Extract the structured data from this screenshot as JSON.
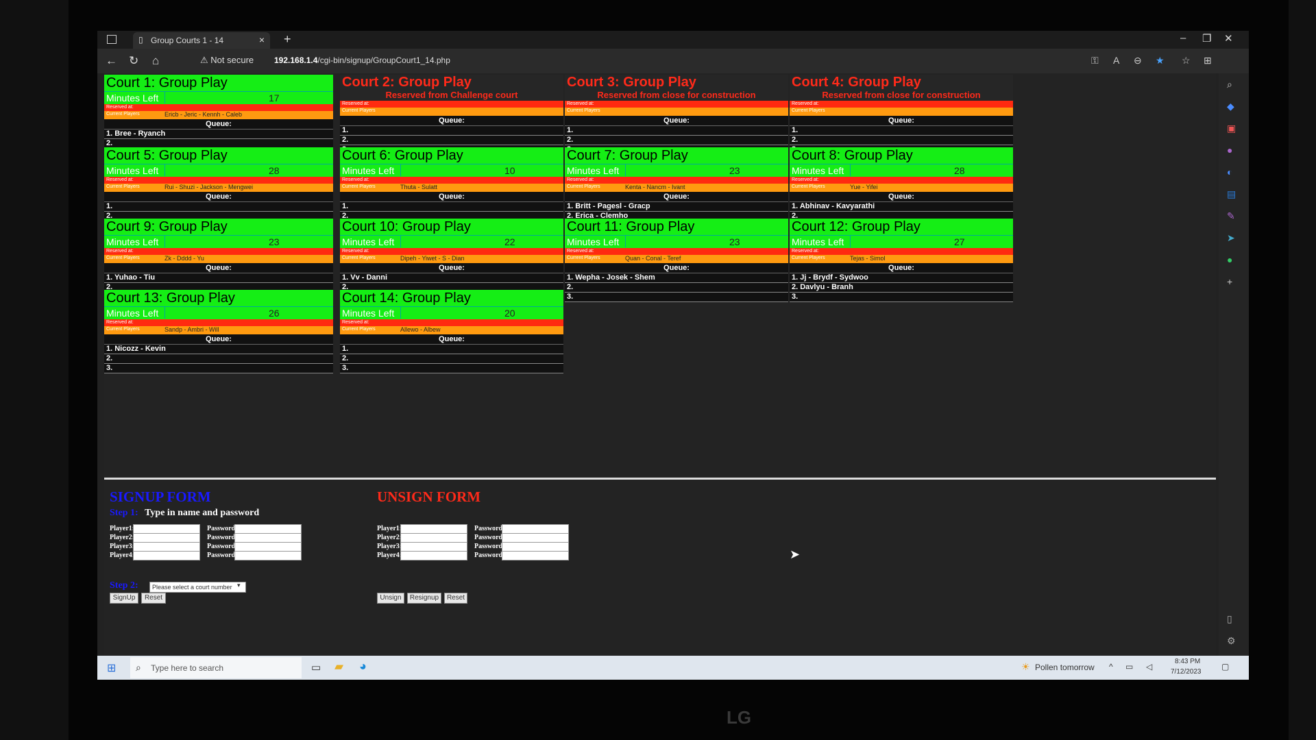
{
  "browser": {
    "tab_title": "Group Courts 1 - 14",
    "security": "Not secure",
    "url_host": "192.168.1.4",
    "url_path": "/cgi-bin/signup/GroupCourt1_14.php"
  },
  "labels": {
    "minutes_left": "Minutes Left",
    "reserved_at": "Reserved at:",
    "current_players": "Current Players",
    "queue": "Queue:"
  },
  "courts": [
    {
      "title": "Court 1: Group Play",
      "minutes": "17",
      "players": "Ericb - Jeric - Kennh - Caleb",
      "queue": [
        "1. Bree - Ryanch",
        "2.",
        "3."
      ]
    },
    {
      "title": "Court 2: Group Play",
      "reserved": "Reserved from Challenge court",
      "minutes": "",
      "players": "",
      "queue": [
        "1.",
        "2.",
        "3."
      ]
    },
    {
      "title": "Court 3: Group Play",
      "reserved": "Reserved from close for construction",
      "minutes": "",
      "players": "",
      "queue": [
        "1.",
        "2.",
        "3."
      ]
    },
    {
      "title": "Court 4: Group Play",
      "reserved": "Reserved from close for construction",
      "minutes": "",
      "players": "",
      "queue": [
        "1.",
        "2.",
        "3."
      ]
    },
    {
      "title": "Court 5: Group Play",
      "minutes": "28",
      "players": "Rui - Shuzi - Jackson - Mengwei",
      "queue": [
        "1.",
        "2.",
        "3."
      ]
    },
    {
      "title": "Court 6: Group Play",
      "minutes": "10",
      "players": "Thuta - Sulatt",
      "queue": [
        "1.",
        "2.",
        "3."
      ]
    },
    {
      "title": "Court 7: Group Play",
      "minutes": "23",
      "players": "Kenta - Nancm - Ivant",
      "queue": [
        "1. Britt - Pagesl - Gracp",
        "2. Erica - Clemho",
        "3."
      ]
    },
    {
      "title": "Court 8: Group Play",
      "minutes": "28",
      "players": "Yue - Yifei",
      "queue": [
        "1. Abhinav - Kavyarathi",
        "2.",
        "3."
      ]
    },
    {
      "title": "Court 9: Group Play",
      "minutes": "23",
      "players": "Zk - Dddd - Yu",
      "queue": [
        "1. Yuhao - Tiu",
        "2.",
        "3."
      ]
    },
    {
      "title": "Court 10: Group Play",
      "minutes": "22",
      "players": "Dipeh - Yiwet - S - Dian",
      "queue": [
        "1. Vv - Danni",
        "2.",
        "3."
      ]
    },
    {
      "title": "Court 11: Group Play",
      "minutes": "23",
      "players": "Quan - Conal - Teref",
      "queue": [
        "1. Wepha - Josek - Shem",
        "2.",
        "3."
      ]
    },
    {
      "title": "Court 12: Group Play",
      "minutes": "27",
      "players": "Tejas - Simol",
      "queue": [
        "1. Jj - Brydf - Sydwoo",
        "2. Davlyu - Branh",
        "3."
      ]
    },
    {
      "title": "Court 13: Group Play",
      "minutes": "26",
      "players": "Sandp - Ambri - Will",
      "queue": [
        "1. Nicozz - Kevin",
        "2.",
        "3."
      ]
    },
    {
      "title": "Court 14: Group Play",
      "minutes": "20",
      "players": "Allewo - Albew",
      "queue": [
        "1.",
        "2.",
        "3."
      ]
    }
  ],
  "signup": {
    "title": "SIGNUP FORM",
    "step1": "Step 1:",
    "step1_text": "Type in name and password",
    "players": [
      "Player1:",
      "Player2:",
      "Player3:",
      "Player4:"
    ],
    "password": "Password:",
    "step2": "Step 2:",
    "select_placeholder": "Please select a court number",
    "signup_btn": "SignUp",
    "reset_btn": "Reset"
  },
  "unsign": {
    "title": "UNSIGN FORM",
    "players": [
      "Player1:",
      "Player2:",
      "Player3:",
      "Player4:"
    ],
    "password": "Password:",
    "unsign_btn": "Unsign",
    "resignup_btn": "Resignup",
    "reset_btn": "Reset"
  },
  "taskbar": {
    "search_placeholder": "Type here to search",
    "weather": "Pollen tomorrow",
    "time": "8:43 PM",
    "date": "7/12/2023"
  },
  "monitor_brand": "LG",
  "colors": {
    "green": "#15ee15",
    "red": "#ff2a10",
    "orange": "#ff9a10",
    "signup_title": "#1a1aff",
    "unsign_title": "#ff2a1a"
  }
}
